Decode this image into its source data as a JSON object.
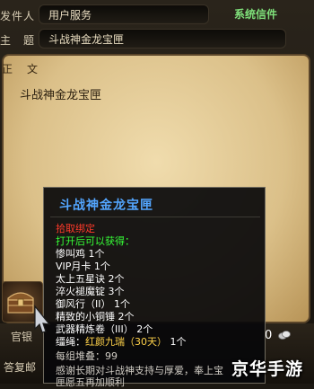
{
  "header": {
    "sender_label": "发件人",
    "sender_value": "用户服务",
    "subject_label": "主　题",
    "subject_value": "斗战神金龙宝匣",
    "system_mail_label": "系统信件"
  },
  "body": {
    "label": "正　文",
    "text": "斗战神金龙宝匣"
  },
  "bottom": {
    "silver_label": "官银",
    "per_group_label": "答复邮",
    "coin_amount": "0"
  },
  "tooltip": {
    "title": "斗战神金龙宝匣",
    "bind": "拾取绑定",
    "open_hint": "打开后可以获得：",
    "items": [
      {
        "name": "惨叫鸡",
        "qty": "1个"
      },
      {
        "name": "VIP月卡",
        "qty": "1个"
      },
      {
        "name": "太上五星诀",
        "qty": "2个"
      },
      {
        "name": "淬火褪魔锭",
        "qty": "3个"
      },
      {
        "name": "御风行（II）",
        "qty": "1个"
      },
      {
        "name": "精致的小铜锤",
        "qty": "2个"
      },
      {
        "name": "武器精炼卷（III）",
        "qty": "2个"
      }
    ],
    "mount_prefix": "缰绳：",
    "mount_name": "红颜九瑞（30天）",
    "mount_qty": "1个",
    "stack_label": "每组堆叠：",
    "stack_value": "99",
    "desc_line1": "感谢长期对斗战神支持与厚爱，奉上宝",
    "desc_line2": "匣愿五再加顺利"
  },
  "watermark": "京华手游",
  "colors": {
    "bind_red": "#ff3a2a",
    "open_green": "#36ff36",
    "title_blue": "#53a6ff",
    "duration_gold": "#ffd24a",
    "system_green": "#7fe07a"
  }
}
